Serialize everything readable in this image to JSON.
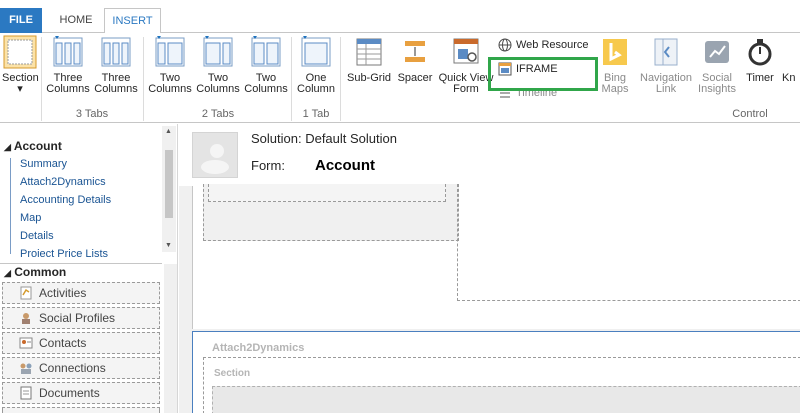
{
  "tabs": {
    "file": "FILE",
    "home": "HOME",
    "insert": "INSERT"
  },
  "ribbon": {
    "section": {
      "label1": "Section",
      "arrow": "▾"
    },
    "three_tabs": {
      "buttons": [
        {
          "line1": "Three",
          "line2": "Columns"
        },
        {
          "line1": "Three",
          "line2": "Columns"
        }
      ],
      "label": "3 Tabs"
    },
    "two_tabs": {
      "buttons": [
        {
          "line1": "Two",
          "line2": "Columns"
        },
        {
          "line1": "Two",
          "line2": "Columns"
        },
        {
          "line1": "Two",
          "line2": "Columns"
        }
      ],
      "label": "2 Tabs"
    },
    "one_tab": {
      "buttons": [
        {
          "line1": "One",
          "line2": "Column"
        }
      ],
      "label": "1 Tab"
    },
    "control": {
      "subgrid": "Sub-Grid",
      "spacer": "Spacer",
      "quickview": {
        "line1": "Quick View",
        "line2": "Form"
      },
      "web_resource": "Web Resource",
      "iframe": "IFRAME",
      "timeline": "Timeline",
      "bing": {
        "line1": "Bing",
        "line2": "Maps"
      },
      "navlink": {
        "line1": "Navigation",
        "line2": "Link"
      },
      "social": {
        "line1": "Social",
        "line2": "Insights"
      },
      "timer": "Timer",
      "kn": "Kn",
      "label": "Control"
    }
  },
  "nav": {
    "header": "Account",
    "links": [
      "Summary",
      "Attach2Dynamics",
      "Accounting Details",
      "Map",
      "Details",
      "Project Price Lists"
    ],
    "common_header": "Common",
    "common_items": [
      "Activities",
      "Social Profiles",
      "Contacts",
      "Connections",
      "Documents"
    ]
  },
  "form": {
    "solution": "Solution: Default Solution",
    "form_label": "Form:",
    "form_name": "Account",
    "tab_title": "Attach2Dynamics",
    "section_title": "Section"
  },
  "colors": {
    "accent": "#2b79c2",
    "highlight": "#30a64a",
    "link": "#1a5493"
  }
}
